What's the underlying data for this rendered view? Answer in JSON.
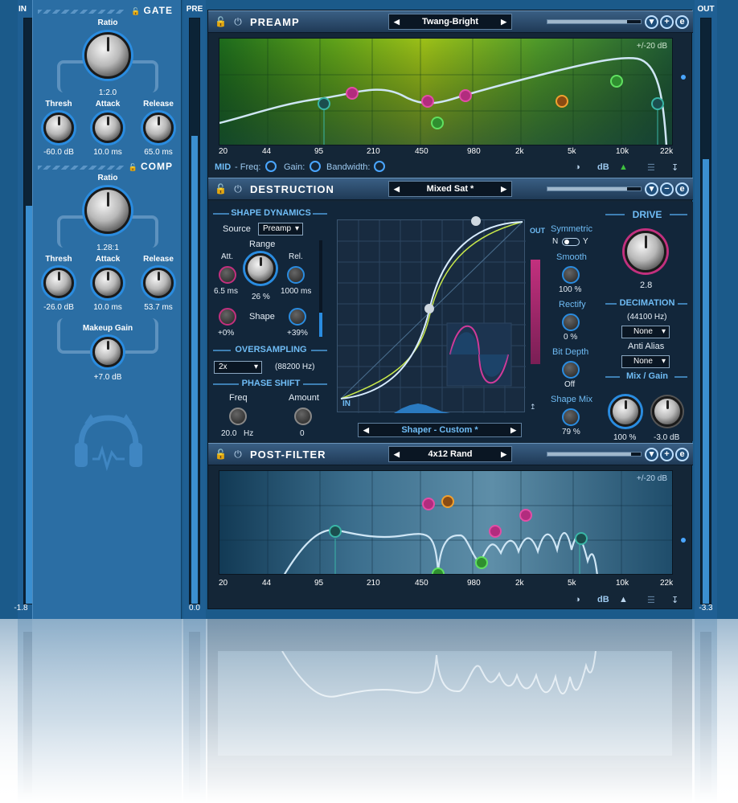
{
  "meters": {
    "in": {
      "label": "IN",
      "value": "-1.8",
      "level": 0.68
    },
    "pre": {
      "label": "PRE",
      "value": "0.0",
      "level": 0.8
    },
    "out": {
      "label": "OUT",
      "value": "-3.3",
      "level": 0.76
    }
  },
  "gate": {
    "title": "GATE",
    "ratio": {
      "label": "Ratio",
      "value": "1:2.0"
    },
    "thresh": {
      "label": "Thresh",
      "value": "-60.0 dB"
    },
    "attack": {
      "label": "Attack",
      "value": "10.0 ms"
    },
    "release": {
      "label": "Release",
      "value": "65.0 ms"
    }
  },
  "comp": {
    "title": "COMP",
    "ratio": {
      "label": "Ratio",
      "value": "1.28:1"
    },
    "thresh": {
      "label": "Thresh",
      "value": "-26.0 dB"
    },
    "attack": {
      "label": "Attack",
      "value": "10.0 ms"
    },
    "release": {
      "label": "Release",
      "value": "53.7 ms"
    },
    "makeup": {
      "label": "Makeup Gain",
      "value": "+7.0 dB"
    }
  },
  "preamp": {
    "title": "PREAMP",
    "preset": "Twang-Bright",
    "range_label": "+/-20 dB",
    "freq_labels": [
      "20",
      "44",
      "95",
      "210",
      "450",
      "980",
      "2k",
      "5k",
      "10k",
      "22k"
    ],
    "band": {
      "name": "MID",
      "freq": "- Freq:",
      "gain": "Gain:",
      "bandwidth": "Bandwidth:"
    },
    "db_label": "dB",
    "slider_level": 0.85
  },
  "destruction": {
    "title": "DESTRUCTION",
    "preset": "Mixed Sat *",
    "slider_level": 0.85,
    "shape_dynamics": {
      "title": "SHAPE DYNAMICS",
      "source_label": "Source",
      "source_value": "Preamp",
      "range_label": "Range",
      "range_value": "26 %",
      "att_label": "Att.",
      "att_value": "6.5 ms",
      "rel_label": "Rel.",
      "rel_value": "1000 ms",
      "shape_label": "Shape",
      "shape_left": "+0%",
      "shape_right": "+39%"
    },
    "oversampling": {
      "title": "OVERSAMPLING",
      "value": "2x",
      "rate": "(88200 Hz)"
    },
    "phase_shift": {
      "title": "PHASE SHIFT",
      "freq_label": "Freq",
      "freq_value": "20.0",
      "freq_unit": "Hz",
      "amount_label": "Amount",
      "amount_value": "0"
    },
    "graph": {
      "in_label": "IN",
      "out_label": "OUT",
      "shaper": "Shaper - Custom *"
    },
    "symmetric": {
      "label": "Symmetric",
      "n": "N",
      "y": "Y"
    },
    "smooth": {
      "label": "Smooth",
      "value": "100 %"
    },
    "rectify": {
      "label": "Rectify",
      "value": "0 %"
    },
    "bit_depth": {
      "label": "Bit Depth",
      "value": "Off"
    },
    "shape_mix": {
      "label": "Shape Mix",
      "value": "79 %"
    },
    "drive": {
      "title": "DRIVE",
      "value": "2.8"
    },
    "decimation": {
      "title": "DECIMATION",
      "rate": "(44100 Hz)",
      "value": "None"
    },
    "anti_alias": {
      "label": "Anti Alias",
      "value": "None"
    },
    "mix_gain": {
      "title": "Mix  /  Gain",
      "mix": "100 %",
      "gain": "-3.0 dB"
    }
  },
  "postfilter": {
    "title": "POST-FILTER",
    "preset": "4x12 Rand",
    "range_label": "+/-20 dB",
    "freq_labels": [
      "20",
      "44",
      "95",
      "210",
      "450",
      "980",
      "2k",
      "5k",
      "10k",
      "22k"
    ],
    "db_label": "dB",
    "slider_level": 0.9
  },
  "colors": {
    "accent": "#2a8ce0",
    "pink": "#d03a9a",
    "green": "#3fc23f",
    "teal": "#39b5a6",
    "orange": "#e08a1e",
    "panel": "#2b6ea4"
  }
}
